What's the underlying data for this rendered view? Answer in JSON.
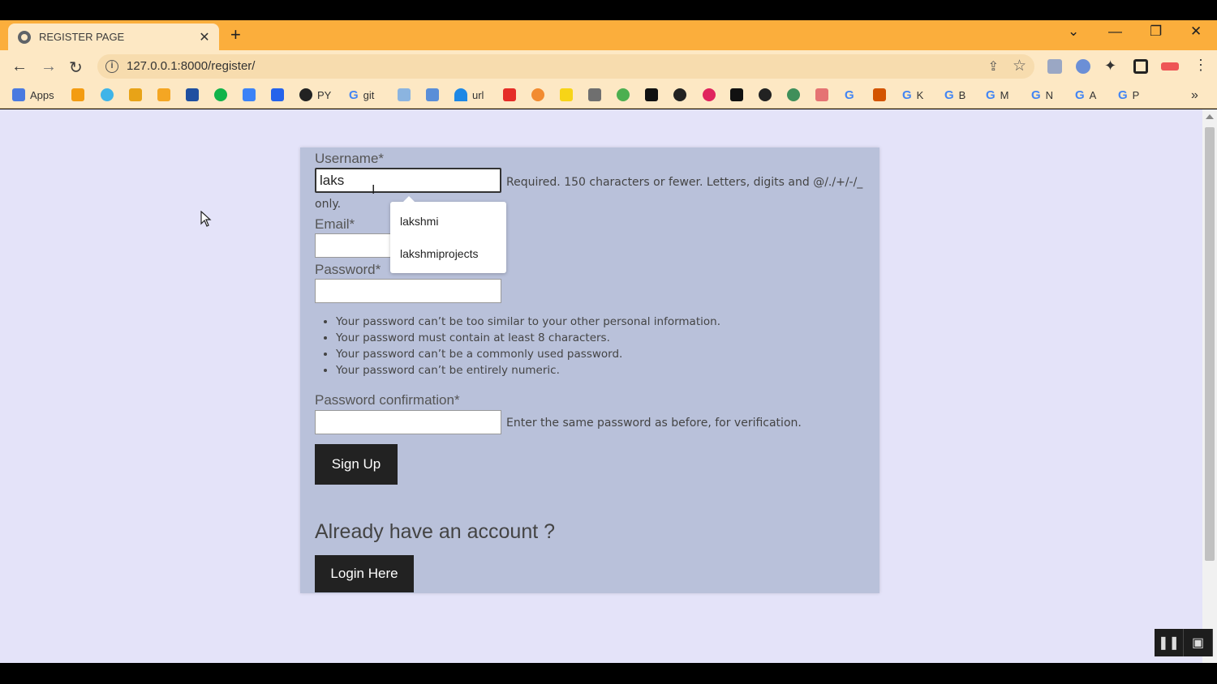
{
  "browser": {
    "tab_title": "REGISTER PAGE",
    "url": "127.0.0.1:8000/register/",
    "bookmarks": [
      {
        "label": "Apps",
        "icon": "apps-grid-icon"
      },
      {
        "label": "PY",
        "icon": "github-icon"
      },
      {
        "label": "git",
        "icon": "google-icon"
      },
      {
        "label": "url",
        "icon": "wifi-icon"
      },
      {
        "label": "K",
        "icon": "google-icon"
      },
      {
        "label": "B",
        "icon": "google-icon"
      },
      {
        "label": "M",
        "icon": "google-icon"
      },
      {
        "label": "N",
        "icon": "google-icon"
      },
      {
        "label": "A",
        "icon": "google-icon"
      },
      {
        "label": "P",
        "icon": "google-icon"
      }
    ],
    "overflow": "»"
  },
  "form": {
    "username_label": "Username*",
    "username_value": "laks",
    "username_help": "Required. 150 characters or fewer. Letters, digits and @/./+/-/_",
    "username_help_cont": "only.",
    "email_label": "Email*",
    "password_label": "Password*",
    "password_rules": [
      "Your password can’t be too similar to your other personal information.",
      "Your password must contain at least 8 characters.",
      "Your password can’t be a commonly used password.",
      "Your password can’t be entirely numeric."
    ],
    "confirm_label": "Password confirmation*",
    "confirm_help": "Enter the same password as before, for verification.",
    "signup_button": "Sign Up",
    "account_heading": "Already have an account ?",
    "login_button": "Login Here"
  },
  "autocomplete": {
    "options": [
      "lakshmi",
      "lakshmiprojects"
    ]
  }
}
